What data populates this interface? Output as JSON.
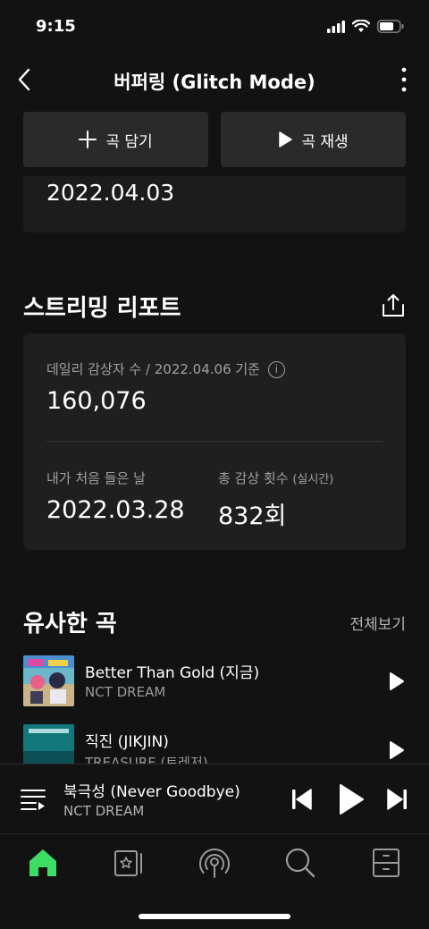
{
  "status": {
    "time": "9:15"
  },
  "header": {
    "title": "버퍼링 (Glitch Mode)"
  },
  "actions": {
    "add_label": "곡 담기",
    "play_label": "곡 재생"
  },
  "previous_card": {
    "date": "2022.04.03"
  },
  "report": {
    "section_title": "스트리밍 리포트",
    "daily_listeners_label": "데일리 감상자 수 / 2022.04.06 기준",
    "daily_listeners_value": "160,076",
    "first_listen_label": "내가 처음 들은 날",
    "first_listen_value": "2022.03.28",
    "total_plays_label": "총 감상 횟수",
    "total_plays_suffix": "(실시간)",
    "total_plays_value": "832회"
  },
  "similar": {
    "section_title": "유사한 곡",
    "see_all": "전체보기",
    "tracks": [
      {
        "title": "Better Than Gold (지금)",
        "artist": "NCT DREAM"
      },
      {
        "title": "직진 (JIKJIN)",
        "artist": "TREASURE (트레저)"
      }
    ]
  },
  "now_playing": {
    "title": "북극성 (Never Goodbye)",
    "artist": "NCT DREAM"
  },
  "colors": {
    "accent": "#3ddc64",
    "background": "#121212",
    "card": "#1f1f1f"
  },
  "tabs": [
    "home-icon",
    "library-icon",
    "podcast-icon",
    "search-icon",
    "storage-icon"
  ]
}
